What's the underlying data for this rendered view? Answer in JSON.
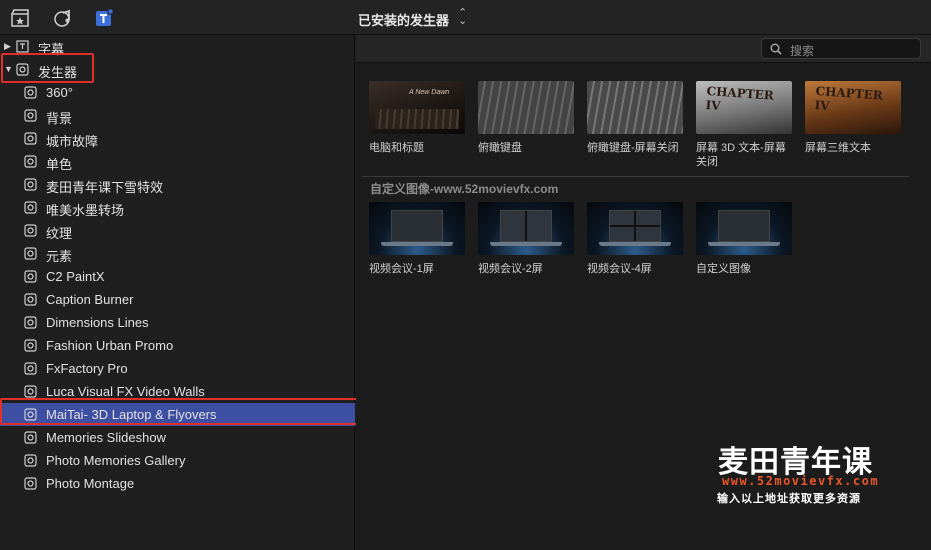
{
  "topbar": {
    "title": "已安装的发生器",
    "icons": [
      "clapper-star-icon",
      "music-notes-icon",
      "title-t-icon"
    ]
  },
  "sidebar": {
    "categories": [
      {
        "label": "字幕",
        "expanded": false
      },
      {
        "label": "发生器",
        "expanded": true
      }
    ],
    "items": [
      "360°",
      "背景",
      "城市故障",
      "单色",
      "麦田青年课下雪特效",
      "唯美水墨转场",
      "纹理",
      "元素",
      "C2 PaintX",
      "Caption Burner",
      "Dimensions Lines",
      "Fashion Urban Promo",
      "FxFactory Pro",
      "Luca Visual FX Video Walls",
      "MaiTai- 3D Laptop & Flyovers",
      "Memories Slideshow",
      "Photo Memories Gallery",
      "Photo Montage"
    ],
    "selected_index": 14
  },
  "search": {
    "placeholder": "搜索"
  },
  "grid": {
    "row1": [
      "电脑和标题",
      "俯瞰键盘",
      "俯瞰键盘-屏幕关闭",
      "屏幕 3D 文本-屏幕关闭",
      "屏幕三维文本"
    ],
    "section_title": "自定义图像-www.52movievfx.com",
    "row2": [
      "视频会议-1屏",
      "视频会议-2屏",
      "视频会议-4屏",
      "自定义图像"
    ],
    "thumb_text": {
      "new_dawn": "A New Dawn",
      "chapter": "CHAPTER IV"
    }
  },
  "watermark": {
    "line1": "麦田青年课",
    "line2": "www.52movievfx.com",
    "line3": "输入以上地址获取更多资源"
  },
  "colors": {
    "selection": "#3d4fa3",
    "highlight_box": "#e0302a",
    "watermark_url": "#e8562b"
  }
}
